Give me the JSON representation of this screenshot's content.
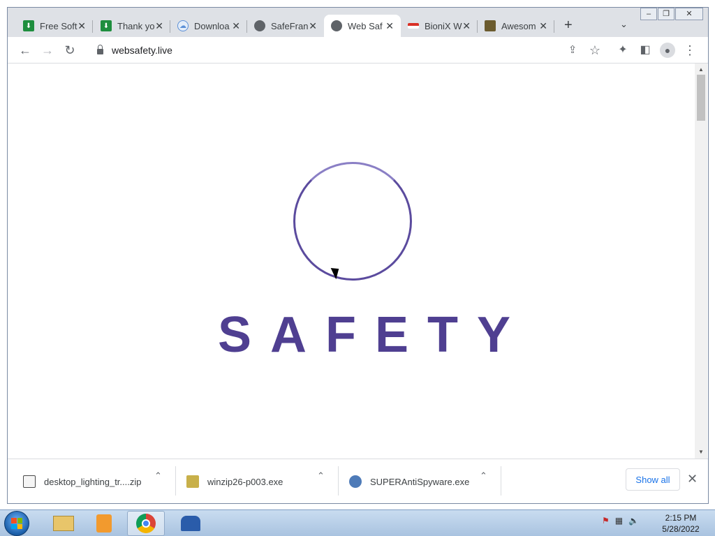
{
  "browser": {
    "tabs": [
      {
        "title": "Free Soft",
        "favicon": "green-download-icon",
        "color": "#1e8e3e"
      },
      {
        "title": "Thank yo",
        "favicon": "green-download-icon",
        "color": "#1e8e3e"
      },
      {
        "title": "Downloa",
        "favicon": "cloud-download-icon",
        "color": "#5b8fd6"
      },
      {
        "title": "SafeFran",
        "favicon": "globe-icon",
        "color": "#5f6368"
      },
      {
        "title": "Web Saf",
        "favicon": "globe-icon",
        "color": "#5f6368",
        "active": true
      },
      {
        "title": "BioniX W",
        "favicon": "red-bar-icon",
        "color": "#d93025"
      },
      {
        "title": "Awesom",
        "favicon": "image-icon",
        "color": "#6b5b2e"
      }
    ],
    "new_tab_icon": "plus-icon",
    "url": "websafety.live"
  },
  "page": {
    "logo_text": "SAFETY",
    "brand_color": "#4f3f91"
  },
  "downloads": {
    "items": [
      {
        "name": "desktop_lighting_tr....zip",
        "icon": "zip-file-icon"
      },
      {
        "name": "winzip26-p003.exe",
        "icon": "installer-icon"
      },
      {
        "name": "SUPERAntiSpyware.exe",
        "icon": "globe-file-icon"
      }
    ],
    "show_all_label": "Show all"
  },
  "taskbar": {
    "time": "2:15 PM",
    "date": "5/28/2022"
  }
}
